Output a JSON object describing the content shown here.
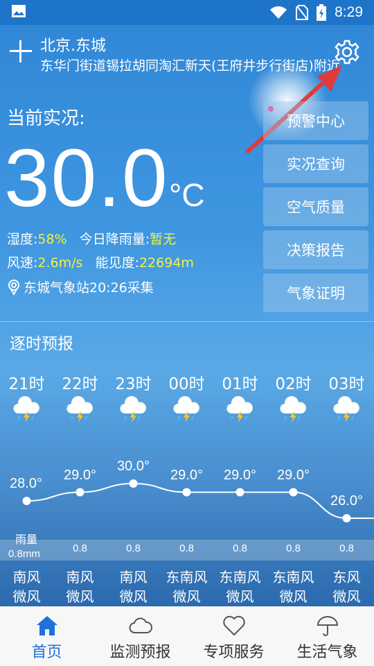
{
  "status_bar": {
    "time": "8:29"
  },
  "header": {
    "city": "北京.东城",
    "address": "东华门街道锡拉胡同淘汇新天(王府井步行街店)附近"
  },
  "current": {
    "label": "当前实况:",
    "temperature": "30.0",
    "unit": "°C",
    "humidity_label": "湿度:",
    "humidity": "58%",
    "rain_label": "今日降雨量:",
    "rain": "暂无",
    "wind_label": "风速:",
    "wind": "2.6m/s",
    "visibility_label": "能见度:",
    "visibility": "22694m",
    "station": "东城气象站20:26采集"
  },
  "side_menu": [
    "预警中心",
    "实况查询",
    "空气质量",
    "决策报告",
    "气象证明"
  ],
  "hourly": {
    "title": "逐时预报",
    "rain_title": "雨量",
    "first_rain_value": "0.8mm",
    "hours": [
      {
        "time": "21时",
        "temp": "28.0°",
        "temp_value": 28.0,
        "rain": "",
        "wind_dir": "南风",
        "wind_force": "微风"
      },
      {
        "time": "22时",
        "temp": "29.0°",
        "temp_value": 29.0,
        "rain": "0.8",
        "wind_dir": "南风",
        "wind_force": "微风"
      },
      {
        "time": "23时",
        "temp": "30.0°",
        "temp_value": 30.0,
        "rain": "0.8",
        "wind_dir": "南风",
        "wind_force": "微风"
      },
      {
        "time": "00时",
        "temp": "29.0°",
        "temp_value": 29.0,
        "rain": "0.8",
        "wind_dir": "东南风",
        "wind_force": "微风"
      },
      {
        "time": "01时",
        "temp": "29.0°",
        "temp_value": 29.0,
        "rain": "0.8",
        "wind_dir": "东南风",
        "wind_force": "微风"
      },
      {
        "time": "02时",
        "temp": "29.0°",
        "temp_value": 29.0,
        "rain": "0.8",
        "wind_dir": "东南风",
        "wind_force": "微风"
      },
      {
        "time": "03时",
        "temp": "26.0°",
        "temp_value": 26.0,
        "rain": "0.8",
        "wind_dir": "东风",
        "wind_force": "微风"
      }
    ]
  },
  "tabs": [
    {
      "label": "首页",
      "icon": "home-icon",
      "active": true
    },
    {
      "label": "监测预报",
      "icon": "cloud-icon",
      "active": false
    },
    {
      "label": "专项服务",
      "icon": "heart-icon",
      "active": false
    },
    {
      "label": "生活气象",
      "icon": "umbrella-icon",
      "active": false
    }
  ],
  "colors": {
    "highlight": "#f4f14a",
    "accent": "#1d72d8",
    "arrow": "#e03a3a"
  }
}
